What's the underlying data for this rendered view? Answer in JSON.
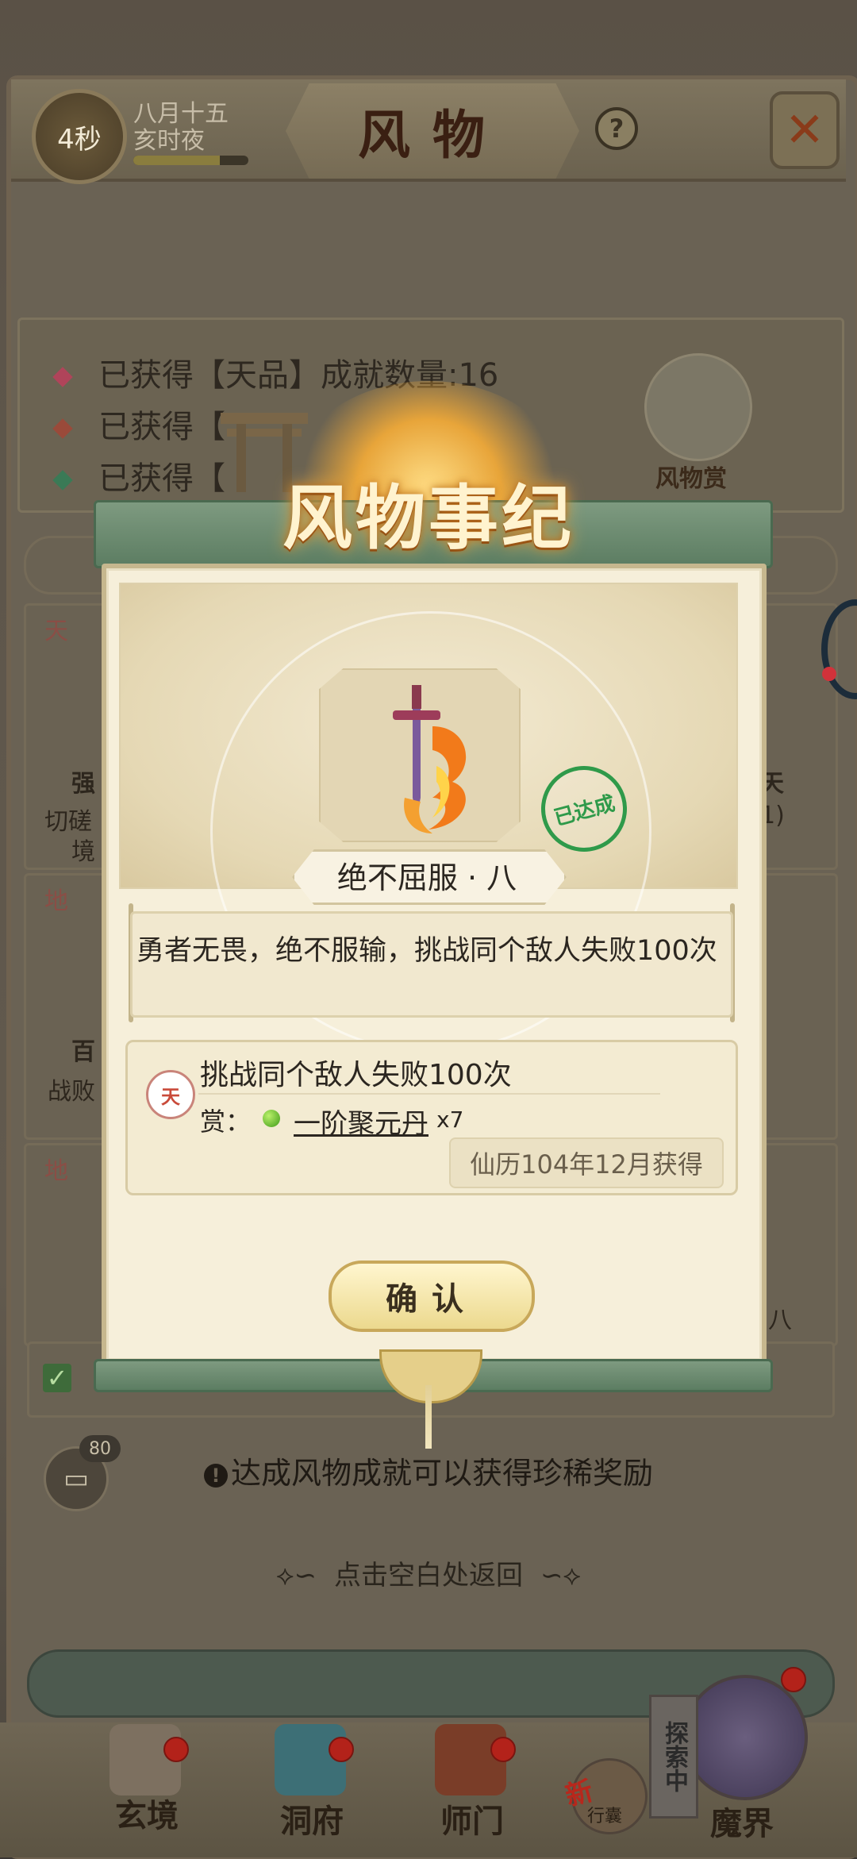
{
  "header": {
    "timer": "4秒",
    "date_line1": "八月十五",
    "date_line2": "亥时夜",
    "title": "风物",
    "help_label": "?",
    "close_label": "✕",
    "energy_fraction": 0.75
  },
  "stats": [
    {
      "text": "已获得【天品】成就数量:16",
      "color": "#b0445a"
    },
    {
      "text": "已获得【",
      "color": "#9a4a3a"
    },
    {
      "text": "已获得【",
      "color": "#3a7a56"
    }
  ],
  "side_character_label": "风物赏",
  "background_fragments": {
    "left_1": "强",
    "left_2": "切磋",
    "left_3": "境",
    "left_4": "百",
    "left_5": "战败",
    "right_1": "天",
    "right_2": "1)",
    "right_3": "八",
    "tag_1": "天",
    "tag_2": "地",
    "tag_3": "地"
  },
  "modal": {
    "banner_title": "风物事纪",
    "achievement_name": "绝不屈服 · 八",
    "stamp_label": "已达成",
    "description": "勇者无畏，绝不服输，挑战同个敌人失败100次",
    "tier_badge": "天",
    "task_title": "挑战同个敌人失败100次",
    "reward_label": "赏：",
    "reward_item": "一阶聚元丹",
    "reward_qty": "x7",
    "obtained_date": "仙历104年12月获得",
    "confirm_label": "确认"
  },
  "chat": {
    "count": "80",
    "icon": "chat-bubble-icon"
  },
  "hint": {
    "icon": "!",
    "text": "达成风物成就可以获得珍稀奖励"
  },
  "return_hint": "点击空白处返回",
  "bottom_nav": [
    {
      "label": "玄境",
      "icon": "scroll-icon"
    },
    {
      "label": "洞府",
      "icon": "pavilion-icon"
    },
    {
      "label": "师门",
      "icon": "banner-icon"
    },
    {
      "label": "行囊",
      "icon": "bag-icon",
      "badge": "新"
    },
    {
      "label": "魔界",
      "icon": "demon-realm-icon"
    }
  ],
  "explore_badge": "探索中",
  "colors": {
    "accent_green": "#5c7d62",
    "stamp_green": "#2f9a4a",
    "gold": "#ecd98e"
  }
}
